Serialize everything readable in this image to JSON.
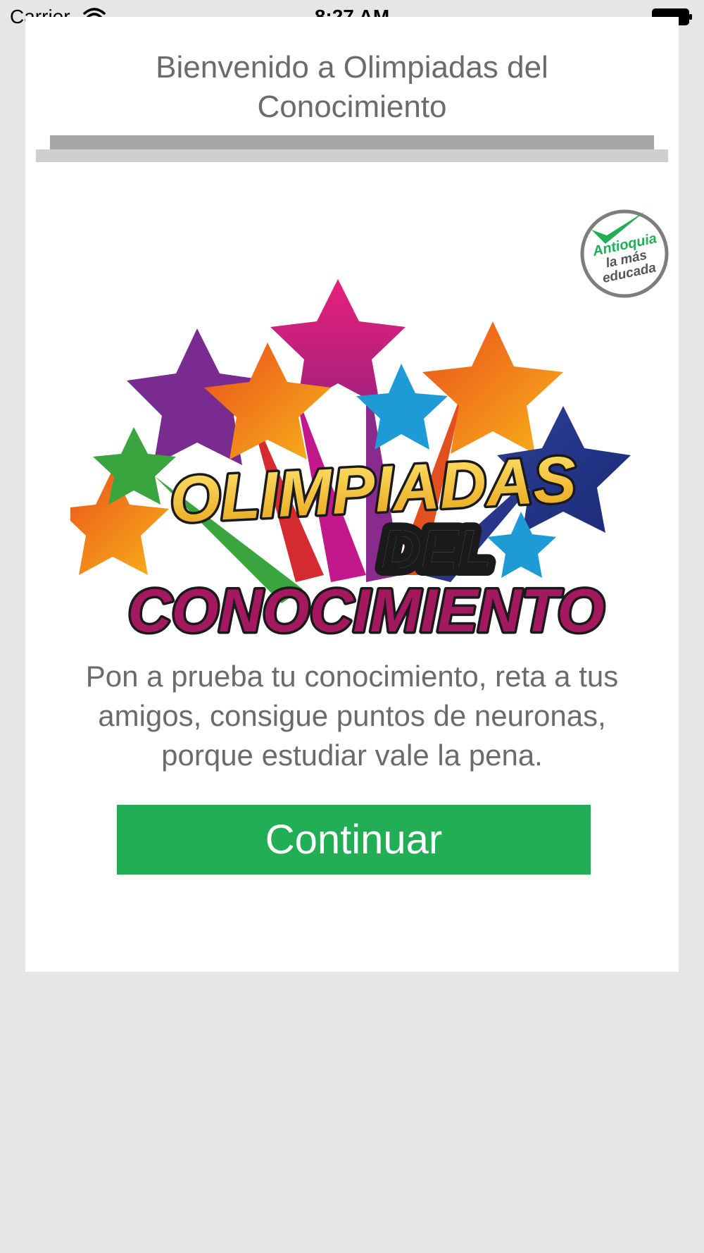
{
  "status_bar": {
    "carrier": "Carrier",
    "time": "8:27 AM"
  },
  "card": {
    "title_line1": "Bienvenido a Olimpiadas del",
    "title_line2": "Conocimiento",
    "badge": {
      "line1": "Antioquia",
      "line2": "la más",
      "line3": "educada"
    },
    "logo": {
      "word1": "OLIMPIADAS",
      "word2": "DEL",
      "word3": "CONOCIMIENTO"
    },
    "description_line1": "Pon a prueba tu conocimiento, reta a tus",
    "description_line2": "amigos, consigue puntos de neuronas,",
    "description_line3": "porque estudiar vale la pena.",
    "continue_label": "Continuar"
  },
  "colors": {
    "accent": "#22ae55",
    "background": "#e6e6e6",
    "text": "#6b6b6b"
  },
  "icons": [
    "wifi-icon",
    "battery-icon",
    "check-icon"
  ]
}
